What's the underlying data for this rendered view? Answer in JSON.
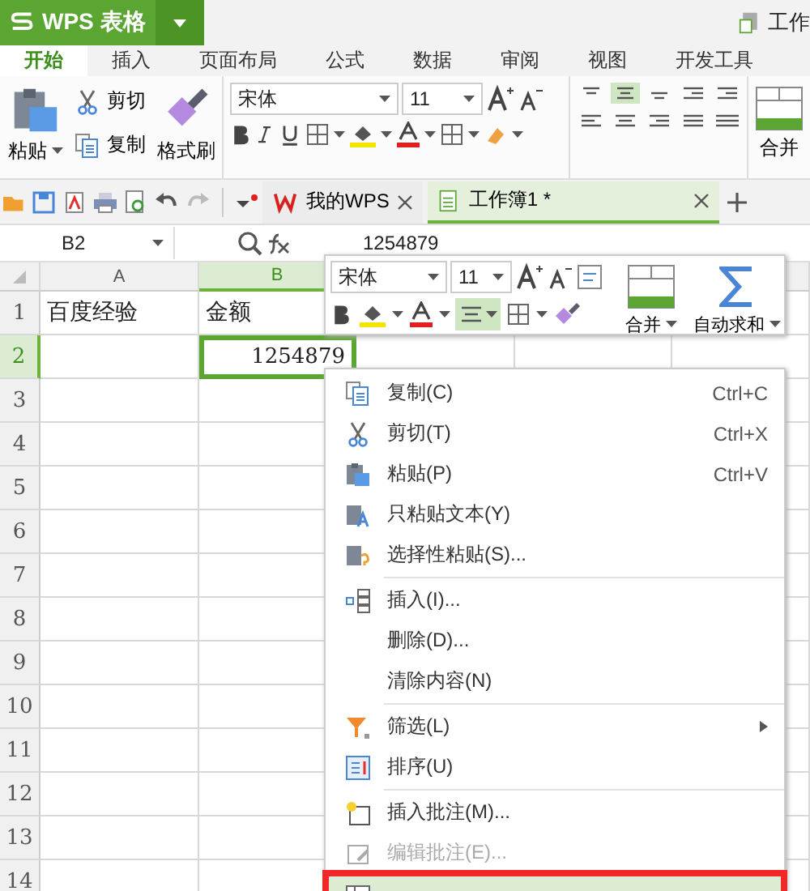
{
  "app_button": {
    "label": "WPS 表格"
  },
  "title_fragment": "工作",
  "ribbon_tabs": [
    {
      "label": "开始",
      "selected": true
    },
    {
      "label": "插入",
      "selected": false
    },
    {
      "label": "页面布局",
      "selected": false
    },
    {
      "label": "公式",
      "selected": false
    },
    {
      "label": "数据",
      "selected": false
    },
    {
      "label": "审阅",
      "selected": false
    },
    {
      "label": "视图",
      "selected": false
    },
    {
      "label": "开发工具",
      "selected": false
    }
  ],
  "clipboard": {
    "paste": "粘贴",
    "cut": "剪切",
    "copy": "复制",
    "format_painter": "格式刷"
  },
  "font": {
    "name": "宋体",
    "size": "11",
    "center_align_on": true
  },
  "merge_label": "合并",
  "doc_tabs": [
    {
      "label": "我的WPS",
      "selected": false
    },
    {
      "label": "工作簿1 *",
      "selected": true
    }
  ],
  "name_box": "B2",
  "formula": "1254879",
  "columns": [
    {
      "label": "A",
      "selected": false
    },
    {
      "label": "B",
      "selected": true
    }
  ],
  "rows": [
    {
      "number": "1",
      "selected": false,
      "cells": {
        "A": {
          "text": "百度经验",
          "kind": "text",
          "active": false
        },
        "B": {
          "text": "金额",
          "kind": "text",
          "active": false
        }
      }
    },
    {
      "number": "2",
      "selected": true,
      "cells": {
        "B": {
          "text": "1254879",
          "kind": "number",
          "active": true
        }
      }
    },
    {
      "number": "3",
      "selected": false
    },
    {
      "number": "4",
      "selected": false
    },
    {
      "number": "5",
      "selected": false
    },
    {
      "number": "6",
      "selected": false
    },
    {
      "number": "7",
      "selected": false
    },
    {
      "number": "8",
      "selected": false
    },
    {
      "number": "9",
      "selected": false
    },
    {
      "number": "10",
      "selected": false
    },
    {
      "number": "11",
      "selected": false
    },
    {
      "number": "12",
      "selected": false
    },
    {
      "number": "13",
      "selected": false
    },
    {
      "number": "14",
      "selected": false
    }
  ],
  "mini_toolbar": {
    "font": "宋体",
    "size": "11",
    "center_align_on": true,
    "merge": "合并",
    "autosum": "自动求和"
  },
  "context_menu": [
    {
      "kind": "item",
      "label": "复制(C)",
      "shortcut": "Ctrl+C",
      "disabled": false
    },
    {
      "kind": "item",
      "label": "剪切(T)",
      "shortcut": "Ctrl+X",
      "disabled": false
    },
    {
      "kind": "item",
      "label": "粘贴(P)",
      "shortcut": "Ctrl+V",
      "disabled": false
    },
    {
      "kind": "item",
      "label": "只粘贴文本(Y)",
      "disabled": false
    },
    {
      "kind": "item",
      "label": "选择性粘贴(S)...",
      "disabled": false
    },
    {
      "kind": "separator"
    },
    {
      "kind": "item",
      "label": "插入(I)...",
      "disabled": false
    },
    {
      "kind": "item",
      "label": "删除(D)...",
      "disabled": false
    },
    {
      "kind": "item",
      "label": "清除内容(N)",
      "disabled": false
    },
    {
      "kind": "separator"
    },
    {
      "kind": "item",
      "label": "筛选(L)",
      "disabled": false,
      "submenu": true
    },
    {
      "kind": "item",
      "label": "排序(U)",
      "disabled": false
    },
    {
      "kind": "separator"
    },
    {
      "kind": "item",
      "label": "插入批注(M)...",
      "disabled": false
    },
    {
      "kind": "item",
      "label": "编辑批注(E)...",
      "disabled": true
    },
    {
      "kind": "partial",
      "selected": true,
      "outlined": true
    }
  ]
}
